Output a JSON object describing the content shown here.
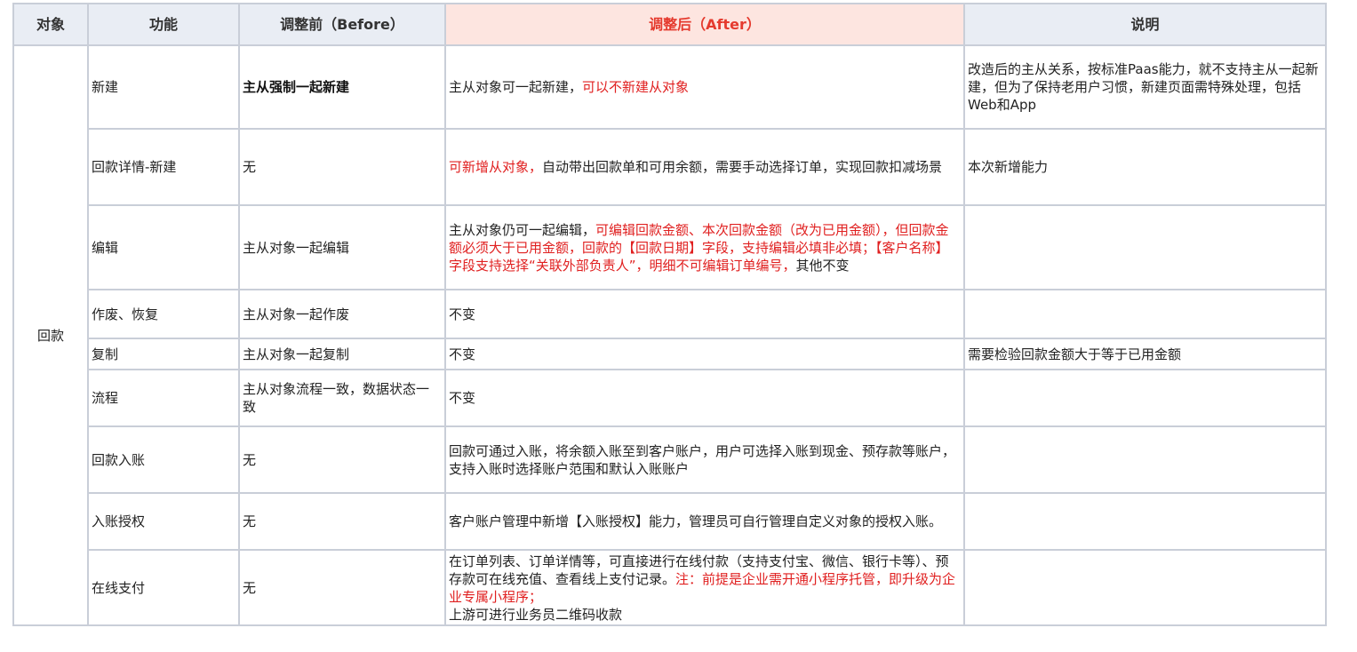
{
  "headers": {
    "object": "对象",
    "function": "功能",
    "before": "调整前（Before）",
    "after": "调整后（After）",
    "note": "说明"
  },
  "object_name": "回款",
  "rows": [
    {
      "function": "新建",
      "before": "主从强制一起新建",
      "after": [
        {
          "t": "主从对象可一起新建，"
        },
        {
          "t": "可以不新建从对象",
          "red": true
        }
      ],
      "note": "改造后的主从关系，按标准Paas能力，就不支持主从一起新建，但为了保持老用户习惯，新建页面需特殊处理，包括Web和App"
    },
    {
      "function": "回款详情-新建",
      "before": "无",
      "after": [
        {
          "t": "可新增从对象，",
          "red": true
        },
        {
          "t": "自动带出回款单和可用余额，需要手动选择订单，实现回款扣减场景"
        }
      ],
      "note": "本次新增能力"
    },
    {
      "function": "编辑",
      "before": "主从对象一起编辑",
      "after": [
        {
          "t": "主从对象仍可一起编辑，"
        },
        {
          "t": "可编辑回款金额、本次回款金额（改为已用金额），但回款金额必须大于已用金额，回款的【回款日期】字段，支持编辑必填非必填；【客户名称】字段支持选择“关联外部负责人”，明细不可编辑订单编号，",
          "red": true
        },
        {
          "t": "其他不变"
        }
      ],
      "note": ""
    },
    {
      "function": "作废、恢复",
      "before": "主从对象一起作废",
      "after": [
        {
          "t": "不变"
        }
      ],
      "note": ""
    },
    {
      "function": "复制",
      "before": "主从对象一起复制",
      "after": [
        {
          "t": "不变"
        }
      ],
      "note": "需要检验回款金额大于等于已用金额"
    },
    {
      "function": "流程",
      "before": "主从对象流程一致，数据状态一致",
      "after": [
        {
          "t": "不变"
        }
      ],
      "note": ""
    },
    {
      "function": "回款入账",
      "before": "无",
      "after": [
        {
          "t": "回款可通过入账，将余额入账至到客户账户，用户可选择入账到现金、预存款等账户，支持入账时选择账户范围和默认入账账户"
        }
      ],
      "note": ""
    },
    {
      "function": "入账授权",
      "before": "无",
      "after": [
        {
          "t": "客户账户管理中新增【入账授权】能力，管理员可自行管理自定义对象的授权入账。"
        }
      ],
      "note": ""
    },
    {
      "function": "在线支付",
      "before": "无",
      "after": [
        {
          "t": "在订单列表、订单详情等，可直接进行在线付款（支持支付宝、微信、银行卡等）、预存款可在线充值、查看线上支付记录。"
        },
        {
          "t": "注：前提是企业需开通小程序托管，即升级为企业专属小程序；",
          "red": true
        },
        {
          "t": "上游可进行业务员二维码收款",
          "br": true
        }
      ],
      "note": ""
    }
  ]
}
